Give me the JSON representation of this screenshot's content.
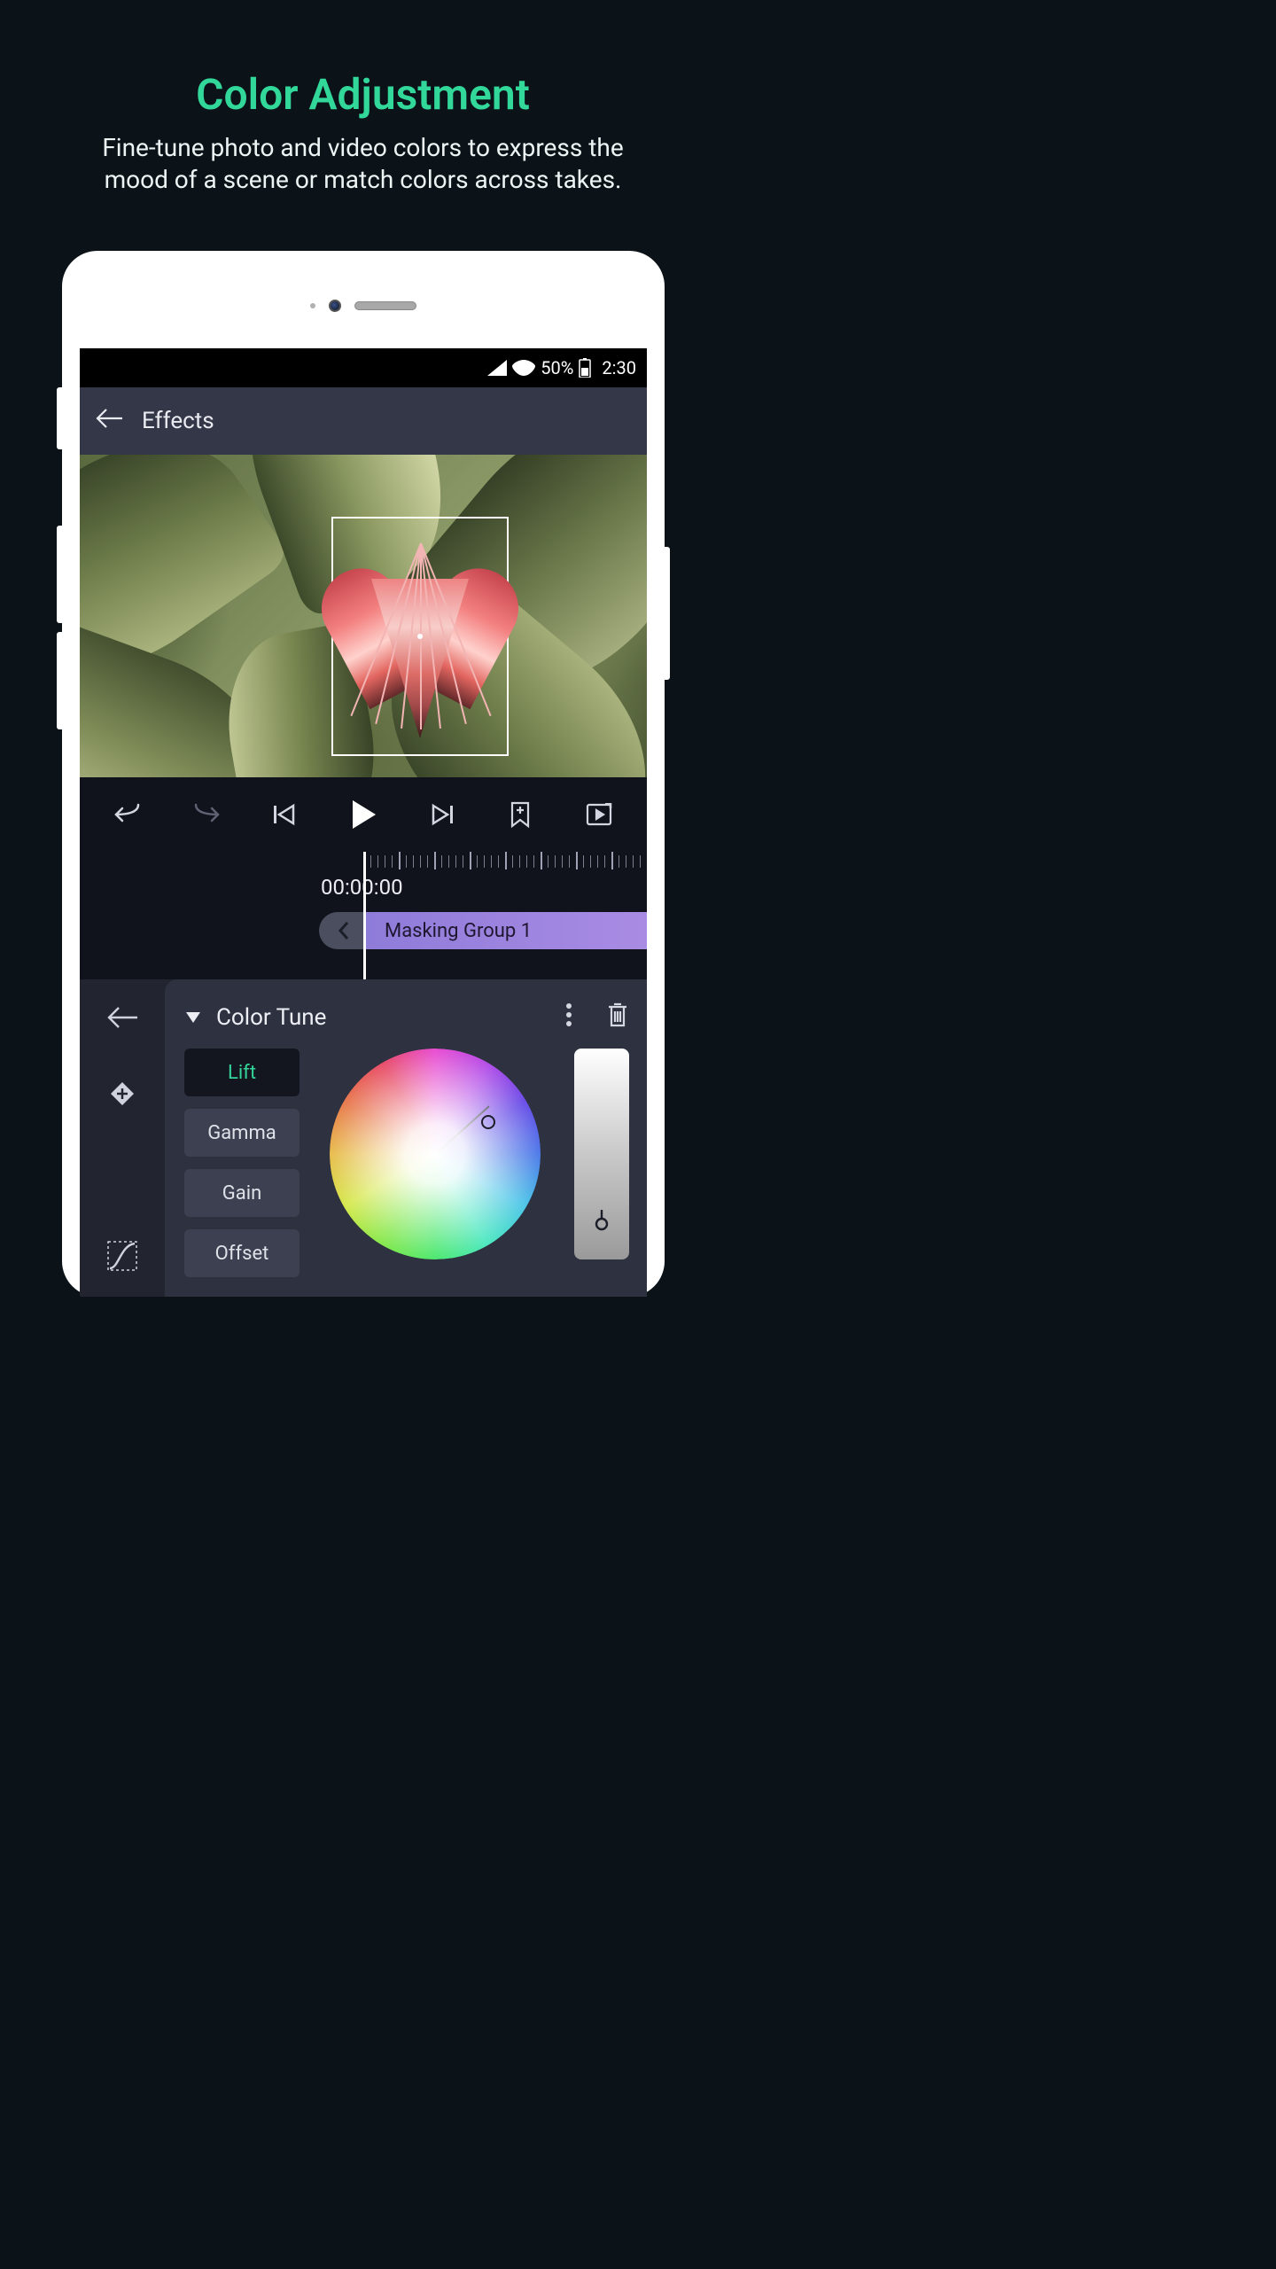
{
  "promo": {
    "title": "Color Adjustment",
    "subtitle": "Fine-tune photo and video colors to express the mood of a scene or match colors across takes."
  },
  "status_bar": {
    "battery_pct": "50%",
    "time": "2:30"
  },
  "app_header": {
    "title": "Effects"
  },
  "timeline": {
    "current_time": "00:00:00",
    "clip_label": "Masking Group 1"
  },
  "effect_panel": {
    "title": "Color Tune",
    "tabs": {
      "lift": "Lift",
      "gamma": "Gamma",
      "gain": "Gain",
      "offset": "Offset"
    },
    "active_tab": "lift"
  },
  "colors": {
    "accent": "#32d79a",
    "bg_dark": "#0b1319"
  }
}
